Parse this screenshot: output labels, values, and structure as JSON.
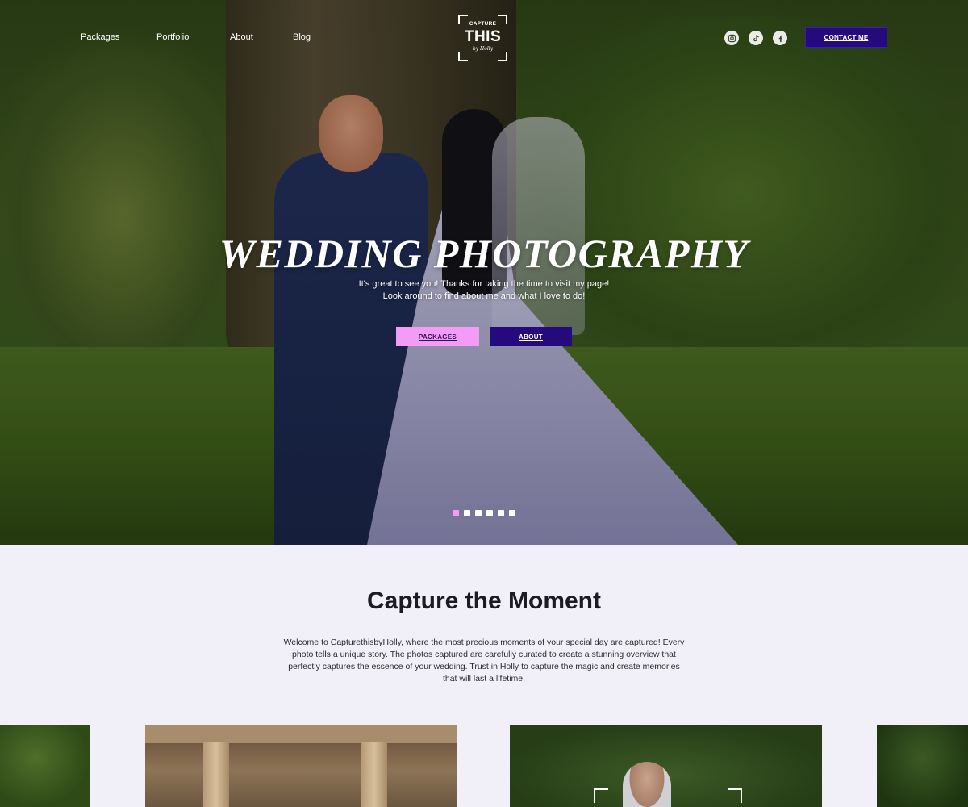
{
  "nav": {
    "links": [
      "Packages",
      "Portfolio",
      "About",
      "Blog"
    ],
    "contact_label": "CONTACT ME"
  },
  "logo": {
    "top_text": "CAPTURE",
    "main_text": "THIS",
    "signature": "by Holly"
  },
  "social": {
    "icons": [
      "instagram-icon",
      "tiktok-icon",
      "facebook-icon"
    ]
  },
  "hero": {
    "title": "WEDDING PHOTOGRAPHY",
    "subtitle_line1": "It's great to see you! Thanks for taking the time to visit my page!",
    "subtitle_line2": "Look around to find about me and what I love to do!",
    "packages_button": "PACKAGES",
    "about_button": "ABOUT",
    "slide_count": 6,
    "active_slide": 1
  },
  "intro": {
    "title": "Capture the Moment",
    "body": "Welcome to CapturethisbyHolly, where the most precious moments of your special day are captured! Every photo tells a unique story. The photos captured are carefully curated to create a stunning overview that perfectly captures the essence of your wedding. Trust in Holly to capture the magic and create memories that will last a lifetime."
  },
  "colors": {
    "accent_purple": "#250a7d",
    "accent_pink": "#f29cf6",
    "section_bg": "#f1eff8"
  }
}
